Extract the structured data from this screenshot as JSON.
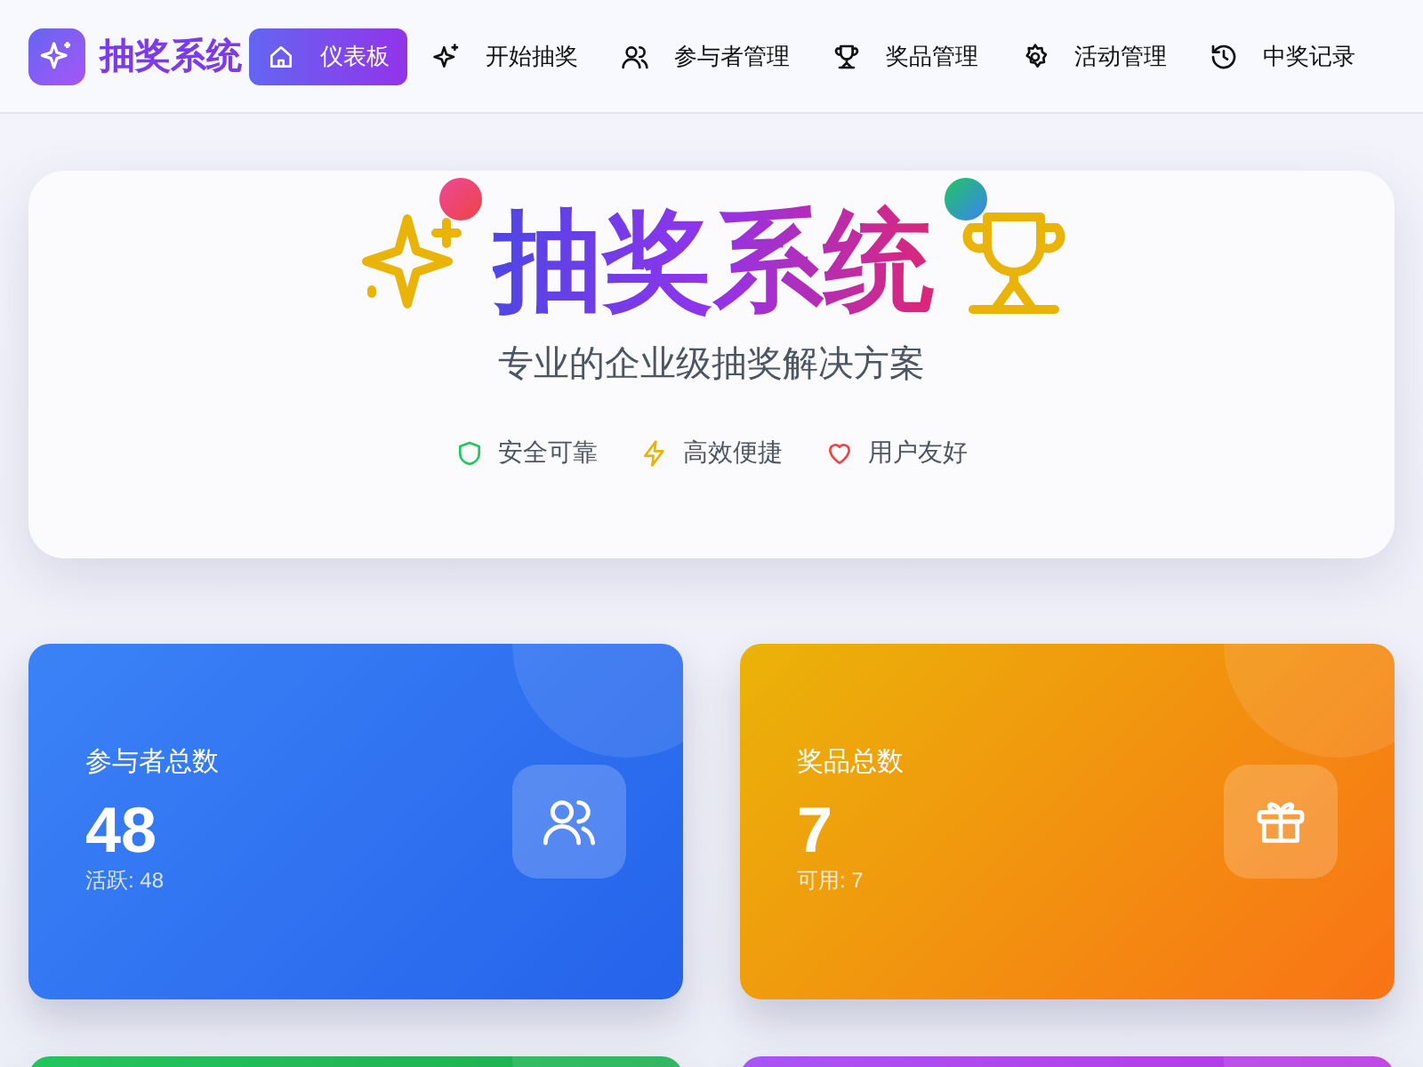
{
  "navbar": {
    "brand": "抽奖系统",
    "items": [
      {
        "label": "仪表板",
        "selected": true
      },
      {
        "label": "开始抽奖",
        "selected": false
      },
      {
        "label": "参与者管理",
        "selected": false
      },
      {
        "label": "奖品管理",
        "selected": false
      },
      {
        "label": "活动管理",
        "selected": false
      },
      {
        "label": "中奖记录",
        "selected": false
      }
    ]
  },
  "hero": {
    "title": "抽奖系统",
    "subtitle": "专业的企业级抽奖解决方案",
    "features": [
      {
        "label": "安全可靠"
      },
      {
        "label": "高效便捷"
      },
      {
        "label": "用户友好"
      }
    ]
  },
  "stat_cards": [
    {
      "kind": "blue",
      "label": "参与者总数",
      "value": "48",
      "detail": "活跃: 48"
    },
    {
      "kind": "orange",
      "label": "奖品总数",
      "value": "7",
      "detail": "可用: 7"
    },
    {
      "kind": "green"
    },
    {
      "kind": "purple"
    }
  ]
}
